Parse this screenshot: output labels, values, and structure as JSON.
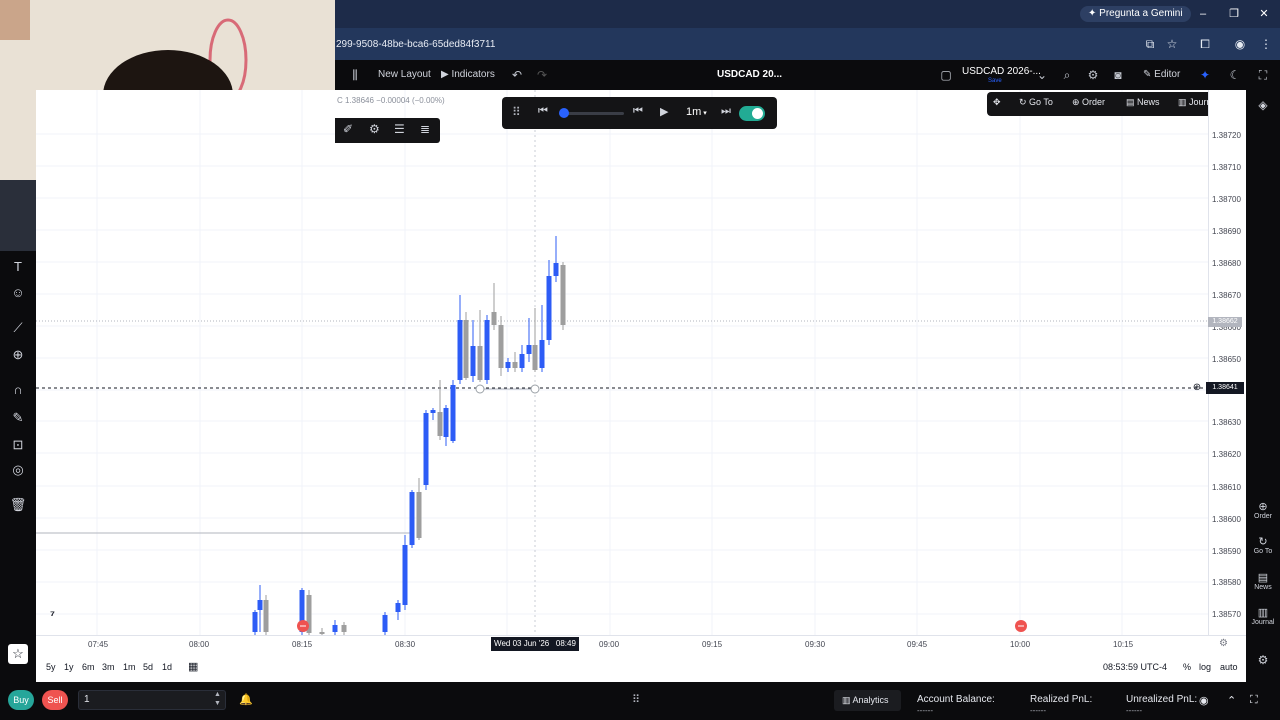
{
  "browser": {
    "url": "299-9508-48be-bca6-65ded84f3711",
    "gemini_label": "Pregunta a Gemini"
  },
  "toolbar": {
    "new_layout": "New Layout",
    "indicators": "Indicators",
    "symbol_center": "USDCAD 20...",
    "symbol_select": "USDCAD 2026-...",
    "symbol_sub": "Save",
    "editor": "Editor"
  },
  "chart": {
    "ohlc_line": "C 1.38646 −0.00004 (−0.00%)",
    "crosshair_price": "1.38641",
    "last_price": "1.38662",
    "crosshair_time": "Wed 03 Jun '26   08:49",
    "price_labels": [
      "1.38720",
      "1.38710",
      "1.38700",
      "1.38690",
      "1.38680",
      "1.38670",
      "1.38660",
      "1.38650",
      "1.38630",
      "1.38620",
      "1.38610",
      "1.38600",
      "1.38590",
      "1.38580",
      "1.38570"
    ],
    "time_labels": [
      "07:45",
      "08:00",
      "08:15",
      "08:30",
      "09:00",
      "09:15",
      "09:30",
      "09:45",
      "10:00",
      "10:15"
    ]
  },
  "replay": {
    "interval": "1m"
  },
  "order_bar": {
    "goto": "Go To",
    "order": "Order",
    "news": "News",
    "journal": "Journal"
  },
  "right_panel": {
    "order": "Order",
    "goto": "Go To",
    "news": "News",
    "journal": "Journal"
  },
  "range_bar": {
    "ranges": [
      "5y",
      "1y",
      "6m",
      "3m",
      "1m",
      "5d",
      "1d"
    ],
    "clock": "08:53:59 UTC-4",
    "percent": "%",
    "log": "log",
    "auto": "auto"
  },
  "bottom": {
    "buy": "Buy",
    "sell": "Sell",
    "quantity": "1",
    "analytics": "Analytics",
    "account_balance_label": "Account Balance:",
    "account_balance_value": "------",
    "realized_label": "Realized PnL:",
    "realized_value": "------",
    "unrealized_label": "Unrealized PnL:",
    "unrealized_value": "------"
  },
  "colors": {
    "bull": "#2d5cf6",
    "bear": "#9e9e9e",
    "accent_green": "#26a69a",
    "buy": "#26a69a",
    "sell": "#ef5350"
  }
}
